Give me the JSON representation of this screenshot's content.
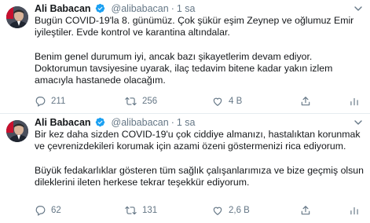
{
  "tweets": [
    {
      "name": "Ali Babacan",
      "handle": "@alibabacan",
      "dot": "·",
      "time": "1 sa",
      "paragraphs": [
        "Bugün COVID-19'la 8. günümüz. Çok şükür eşim Zeynep ve oğlumuz Emir iyileştiler. Evde kontrol ve karantina altındalar.",
        "Benim genel durumum iyi, ancak bazı şikayetlerim devam ediyor. Doktorumun tavsiyesine uyarak, ilaç tedavim bitene kadar yakın izlem amacıyla hastanede olacağım."
      ],
      "reply_count": "211",
      "retweet_count": "256",
      "like_count": "4 B"
    },
    {
      "name": "Ali Babacan",
      "handle": "@alibabacan",
      "dot": "·",
      "time": "1 sa",
      "paragraphs": [
        "Bir kez daha sizden COVID-19'u çok ciddiye almanızı, hastalıktan korunmak ve çevrenizdekileri korumak için azami özeni göstermenizi rica ediyorum.",
        "Büyük fedakarlıklar gösteren tüm sağlık çalışanlarımıza ve bize geçmiş olsun dileklerini ileten herkese tekrar teşekkür ediyorum."
      ],
      "reply_count": "62",
      "retweet_count": "131",
      "like_count": "2,6 B"
    }
  ],
  "icons": {
    "reply": "reply-icon",
    "retweet": "retweet-icon",
    "like": "heart-icon",
    "share": "share-icon",
    "stats": "analytics-icon",
    "verified": "verified-badge-icon",
    "more": "chevron-down-icon"
  },
  "colors": {
    "text": "#14171a",
    "secondary": "#657786",
    "verified": "#1da1f2",
    "divider": "#e6ecf0"
  }
}
